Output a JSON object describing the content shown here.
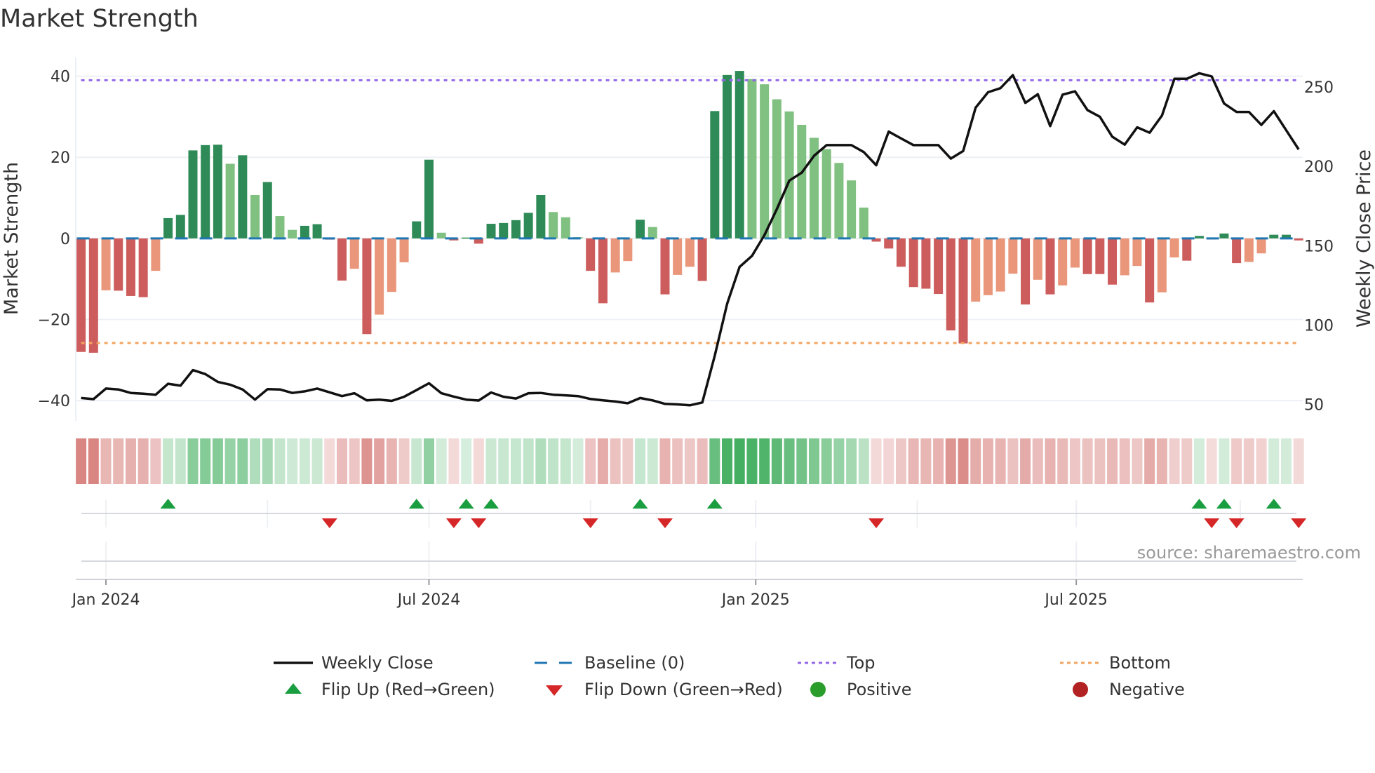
{
  "chart_data": {
    "type": "bar",
    "title": "Market Strength",
    "ylabel": "Market Strength",
    "y2label": "Weekly Close Price",
    "ylim": [
      -45,
      44.6
    ],
    "y2lim": [
      39.6,
      268.6
    ],
    "yticks": [
      40,
      20,
      0,
      -20,
      -40
    ],
    "ytick_labels": [
      "40",
      "20",
      "0",
      "−20",
      "−40"
    ],
    "y2ticks": [
      250,
      200,
      150,
      100,
      50
    ],
    "y2tick_labels": [
      "250",
      "200",
      "150",
      "100",
      "50"
    ],
    "x_start_date": "2023-12-18",
    "x_frequency": "weekly",
    "xticks": [
      {
        "label": "Jan 2024",
        "week": 2
      },
      {
        "label": "Jul 2024",
        "week": 28
      },
      {
        "label": "Jan 2025",
        "week": 54.3
      },
      {
        "label": "Jul 2025",
        "week": 80.1
      }
    ],
    "top_level": 39,
    "bottom_level": -25.8,
    "baseline": 0,
    "strength": [
      -28,
      -28.2,
      -12.8,
      -12.9,
      -14.2,
      -14.5,
      -8,
      5,
      5.8,
      21.7,
      23,
      23.1,
      18.4,
      20.5,
      10.7,
      13.9,
      5.5,
      2.1,
      3.1,
      3.5,
      -0.3,
      -10.4,
      -7.5,
      -23.6,
      -18.8,
      -13.2,
      -5.9,
      4.2,
      19.4,
      1.4,
      -0.5,
      0.2,
      -1.3,
      3.6,
      3.8,
      4.5,
      6.3,
      10.7,
      6.5,
      5.2,
      0.3,
      -8,
      -16,
      -8.4,
      -5.6,
      4.6,
      2.8,
      -13.8,
      -9,
      -7,
      -10.5,
      31.4,
      40.3,
      41.3,
      39.3,
      38,
      34.3,
      31.3,
      28,
      24.8,
      22,
      18.6,
      14.3,
      7.6,
      -0.8,
      -2.5,
      -7,
      -12,
      -12.4,
      -13.7,
      -22.7,
      -25.9,
      -15.6,
      -14,
      -13.1,
      -8.7,
      -16.3,
      -10.2,
      -13.8,
      -11.6,
      -7.2,
      -8.8,
      -8.8,
      -11.4,
      -9.1,
      -6.8,
      -15.8,
      -13.3,
      -4.7,
      -5.5,
      0.6,
      -0.2,
      1.2,
      -6.1,
      -5.8,
      -3.7,
      0.9,
      0.9,
      -0.5
    ],
    "weekly_close": [
      54.0,
      53.3,
      60.0,
      59.4,
      57.2,
      56.7,
      56.1,
      63.0,
      61.8,
      71.6,
      69.1,
      64.2,
      62.4,
      59.4,
      53.0,
      59.6,
      59.4,
      57.2,
      58.2,
      60.0,
      57.6,
      55.2,
      57.0,
      52.5,
      53.0,
      52.2,
      54.8,
      59.0,
      63.3,
      57.0,
      54.9,
      53.0,
      52.4,
      57.5,
      54.8,
      53.7,
      57.0,
      57.2,
      56.1,
      55.7,
      55.2,
      53.4,
      52.5,
      51.8,
      50.7,
      54.0,
      52.5,
      50.3,
      50.0,
      49.4,
      51.2,
      80.6,
      113.4,
      136.6,
      143.6,
      156.7,
      173.1,
      191.0,
      196.0,
      206.7,
      213.4,
      213.4,
      213.4,
      209.0,
      200.7,
      221.9,
      217.6,
      213.4,
      213.4,
      213.4,
      204.9,
      209.7,
      237.0,
      246.7,
      249.3,
      257.5,
      240.0,
      245.5,
      225.4,
      245.2,
      247.3,
      235.5,
      231.3,
      218.7,
      213.7,
      224.6,
      221.2,
      232.1,
      255.2,
      255.2,
      258.7,
      256.7,
      239.6,
      234.3,
      234.3,
      226.1,
      234.8,
      222.7,
      210.7
    ],
    "flip_up_weeks": [
      7,
      27,
      31,
      33,
      45,
      51,
      90,
      92,
      96
    ],
    "flip_down_weeks": [
      20,
      30,
      32,
      41,
      47,
      64,
      91,
      93,
      98
    ],
    "legend": {
      "placement": "bottom",
      "entries": [
        {
          "key": "close",
          "label": "Weekly Close"
        },
        {
          "key": "baseline",
          "label": "Baseline (0)"
        },
        {
          "key": "top",
          "label": "Top"
        },
        {
          "key": "bottom",
          "label": "Bottom"
        },
        {
          "key": "flip_up",
          "label": "Flip Up (Red→Green)"
        },
        {
          "key": "flip_down",
          "label": "Flip Down (Green→Red)"
        },
        {
          "key": "positive",
          "label": "Positive"
        },
        {
          "key": "negative",
          "label": "Negative"
        }
      ]
    },
    "source": "source: sharemaestro.com",
    "colors": {
      "pos_strong": "#2e8b57",
      "pos_weak": "#80c080",
      "neg_strong": "#cd5c5c",
      "neg_weak": "#e9967a",
      "heat_pos": "#34a853",
      "heat_neg": "#c8504b",
      "close": "#111111",
      "baseline": "#1f77b4",
      "top": "#9467e8",
      "bottom": "#f4a460",
      "flip_up": "#1a9e3f",
      "flip_down": "#d62728",
      "positive": "#2a9d2a",
      "negative": "#b22222"
    }
  }
}
